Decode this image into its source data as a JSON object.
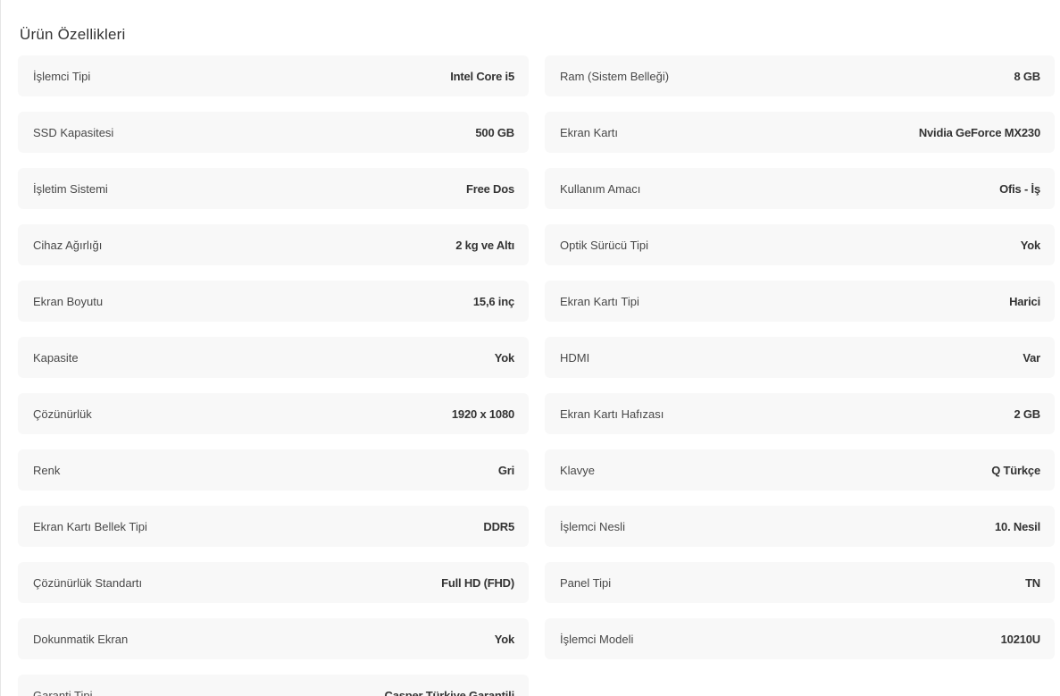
{
  "section": {
    "title": "Ürün Özellikleri"
  },
  "specs": [
    {
      "label": "İşlemci Tipi",
      "value": "Intel Core i5"
    },
    {
      "label": "Ram (Sistem Belleği)",
      "value": "8 GB"
    },
    {
      "label": "SSD Kapasitesi",
      "value": "500 GB"
    },
    {
      "label": "Ekran Kartı",
      "value": "Nvidia GeForce MX230"
    },
    {
      "label": "İşletim Sistemi",
      "value": "Free Dos"
    },
    {
      "label": "Kullanım Amacı",
      "value": "Ofis - İş"
    },
    {
      "label": "Cihaz Ağırlığı",
      "value": "2 kg ve Altı"
    },
    {
      "label": "Optik Sürücü Tipi",
      "value": "Yok"
    },
    {
      "label": "Ekran Boyutu",
      "value": "15,6 inç"
    },
    {
      "label": "Ekran Kartı Tipi",
      "value": "Harici"
    },
    {
      "label": "Kapasite",
      "value": "Yok"
    },
    {
      "label": "HDMI",
      "value": "Var"
    },
    {
      "label": "Çözünürlük",
      "value": "1920 x 1080"
    },
    {
      "label": "Ekran Kartı Hafızası",
      "value": "2 GB"
    },
    {
      "label": "Renk",
      "value": "Gri"
    },
    {
      "label": "Klavye",
      "value": "Q Türkçe"
    },
    {
      "label": "Ekran Kartı Bellek Tipi",
      "value": "DDR5"
    },
    {
      "label": "İşlemci Nesli",
      "value": "10. Nesil"
    },
    {
      "label": "Çözünürlük Standartı",
      "value": "Full HD (FHD)"
    },
    {
      "label": "Panel Tipi",
      "value": "TN"
    },
    {
      "label": "Dokunmatik Ekran",
      "value": "Yok"
    },
    {
      "label": "İşlemci Modeli",
      "value": "10210U"
    },
    {
      "label": "Garanti Tipi",
      "value": "Casper Türkiye Garantili"
    }
  ]
}
